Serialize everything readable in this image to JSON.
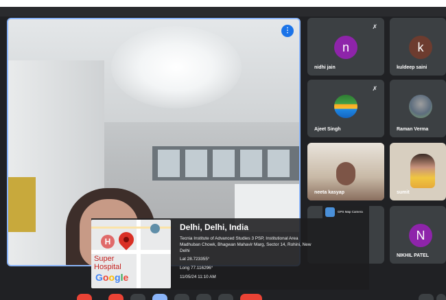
{
  "main_tile": {
    "pin_icon": "pin-icon"
  },
  "participants": [
    {
      "name": "nidhi jain",
      "initial": "n",
      "avatar_color": "#8e24aa",
      "muted": true
    },
    {
      "name": "kuldeep saini",
      "initial": "k",
      "avatar_color": "#6d3c2f",
      "muted": true
    },
    {
      "name": "Ajeet Singh",
      "initial": "",
      "avatar_color": "",
      "muted": true
    },
    {
      "name": "Raman Verma",
      "initial": "",
      "avatar_color": "",
      "muted": false
    },
    {
      "name": "neeta kasyap",
      "initial": "",
      "avatar_color": "",
      "muted": false
    },
    {
      "name": "sumit",
      "initial": "",
      "avatar_color": "",
      "muted": false
    },
    {
      "name": "NIKHIL PATEL",
      "initial": "N",
      "avatar_color": "#8e24aa",
      "muted": false
    }
  ],
  "gps": {
    "app_name": "GPS Map Camera",
    "title": "Delhi, Delhi, India",
    "address_line1": "Tecnia Institute of Advanced Studies 3 PSP, Institutional Area",
    "address_line2": "Madhuban Chowk, Bhagwan Mahavir Marg, Sector 14, Rohini, New",
    "address_line3": "Delhi",
    "lat": "Lat 28.723355°",
    "long": "Long 77.116296°",
    "datetime": "11/05/24 11:10 AM",
    "map_label_1": "Super",
    "map_label_2": "Hospital",
    "map_brand": "Google"
  },
  "colors": {
    "speaker_border": "#8ab4f8",
    "tile_bg": "#3c4043",
    "control_red": "#ea4335"
  }
}
